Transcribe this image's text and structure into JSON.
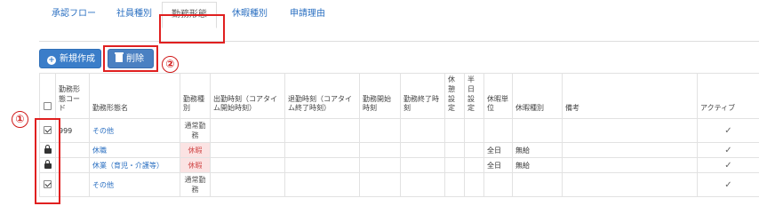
{
  "tabs": [
    {
      "label": "承認フロー"
    },
    {
      "label": "社員種別"
    },
    {
      "label": "勤務形態"
    },
    {
      "label": "休暇種別"
    },
    {
      "label": "申請理由"
    }
  ],
  "toolbar": {
    "new_label": "新規作成",
    "delete_label": "削除"
  },
  "annotations": {
    "one": "①",
    "two": "②"
  },
  "table": {
    "headers": {
      "code": "勤務形態コード",
      "name": "勤務形態名",
      "category": "勤務種別",
      "start": "出勤時刻（コアタイム開始時刻）",
      "end": "退勤時刻（コアタイム終了時刻）",
      "work_start": "勤務開始時刻",
      "work_end": "勤務終了時刻",
      "break": "休憩設定",
      "halfday": "半日設定",
      "holiday_unit": "休暇単位",
      "holiday_type": "休暇種別",
      "note": "備考",
      "active": "アクティブ"
    },
    "rows": [
      {
        "select": "checked",
        "code": "999",
        "name": "その他",
        "category": "通常勤務",
        "holiday_unit": "",
        "holiday_type": "",
        "active": "✓"
      },
      {
        "select": "locked",
        "code": "",
        "name": "休職",
        "category": "休暇",
        "holiday_unit": "全日",
        "holiday_type": "無給",
        "active": "✓"
      },
      {
        "select": "locked",
        "code": "",
        "name": "休業（育児・介護等）",
        "category": "休暇",
        "holiday_unit": "全日",
        "holiday_type": "無給",
        "active": "✓"
      },
      {
        "select": "checked",
        "code": "",
        "name": "その他",
        "category": "通常勤務",
        "holiday_unit": "",
        "holiday_type": "",
        "active": "✓"
      }
    ]
  }
}
